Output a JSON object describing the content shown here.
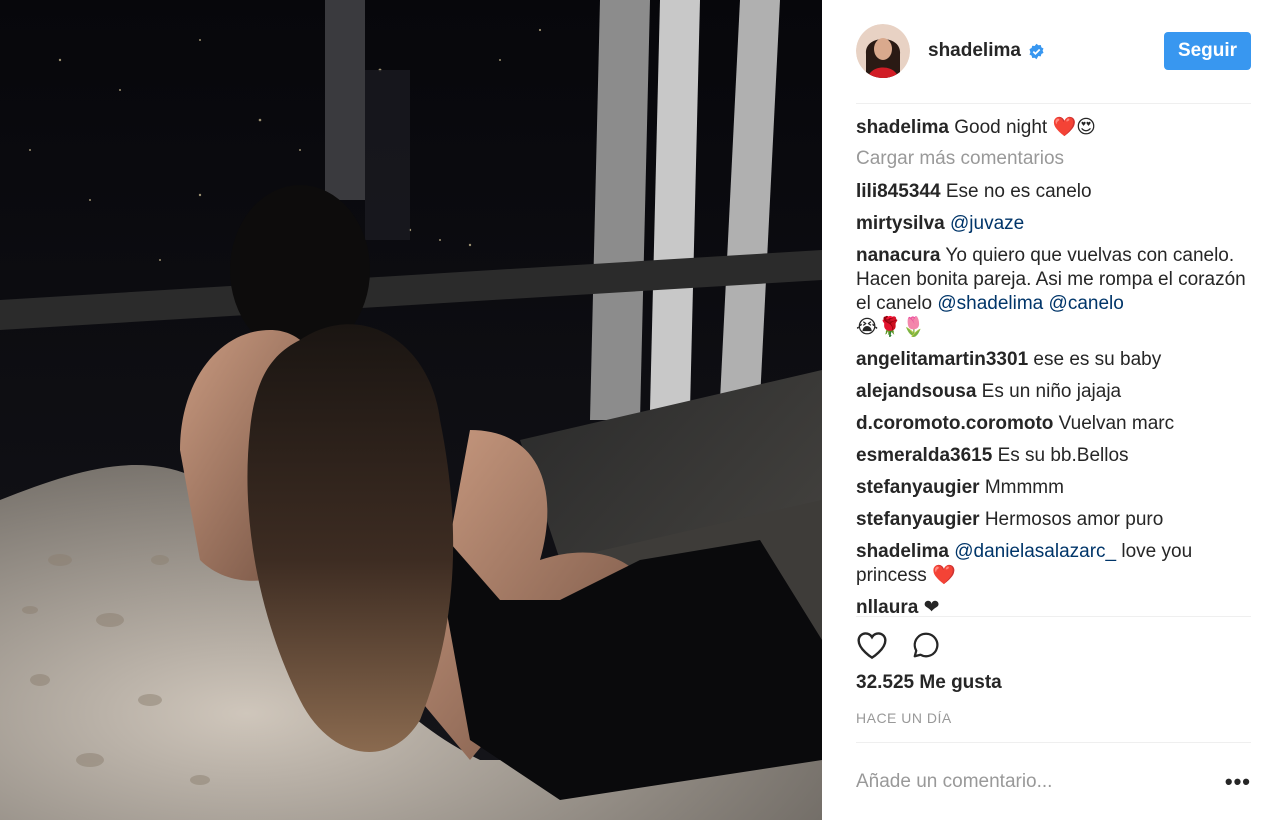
{
  "header": {
    "username": "shadelima",
    "verified_icon": "verified-badge-icon",
    "follow_label": "Seguir",
    "accent": "#3897f0"
  },
  "caption": {
    "user": "shadelima",
    "text": "Good night ❤️😍"
  },
  "load_more": "Cargar más comentarios",
  "comments": [
    {
      "user": "lili845344",
      "text": "Ese no es canelo"
    },
    {
      "user": "mirtysilva",
      "mention": "@juvaze"
    },
    {
      "user": "nanacura",
      "text": "Yo quiero que vuelvas con canelo. Hacen bonita pareja. Asi me rompa el corazón el canelo",
      "mentions": [
        "@shadelima",
        "@canelo"
      ],
      "emoji": "😭🌹🌷"
    },
    {
      "user": "angelitamartin3301",
      "text": "ese es su baby"
    },
    {
      "user": "alejandsousa",
      "text": "Es un niño jajaja"
    },
    {
      "user": "d.coromoto.coromoto",
      "text": "Vuelvan marc"
    },
    {
      "user": "esmeralda3615",
      "text": "Es su bb.Bellos"
    },
    {
      "user": "stefanyaugier",
      "text": "Mmmmm"
    },
    {
      "user": "stefanyaugier",
      "text": "Hermosos amor puro"
    },
    {
      "user": "shadelima",
      "mention": "@danielasalazarc_",
      "text": "love you princess ❤️"
    },
    {
      "user": "nllaura",
      "text": "❤"
    }
  ],
  "actions": {
    "like_icon": "heart-icon",
    "comment_icon": "comment-bubble-icon"
  },
  "likes": "32.525 Me gusta",
  "timestamp": "HACE UN DÍA",
  "add_comment": {
    "placeholder": "Añade un comentario...",
    "more_label": "•••"
  }
}
